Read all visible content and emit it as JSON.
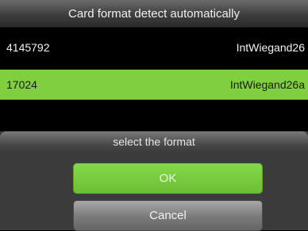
{
  "header": {
    "title": "Card format detect automatically"
  },
  "list": {
    "rows": [
      {
        "number": "4145792",
        "format": "IntWiegand26"
      },
      {
        "number": "17024",
        "format": "IntWiegand26a"
      }
    ]
  },
  "dialog": {
    "title": "select the format",
    "ok_label": "OK",
    "cancel_label": "Cancel"
  },
  "colors": {
    "selected_row": "#7fcf3f",
    "ok_button": "#76c93d",
    "cancel_button": "#8a8a8a"
  }
}
